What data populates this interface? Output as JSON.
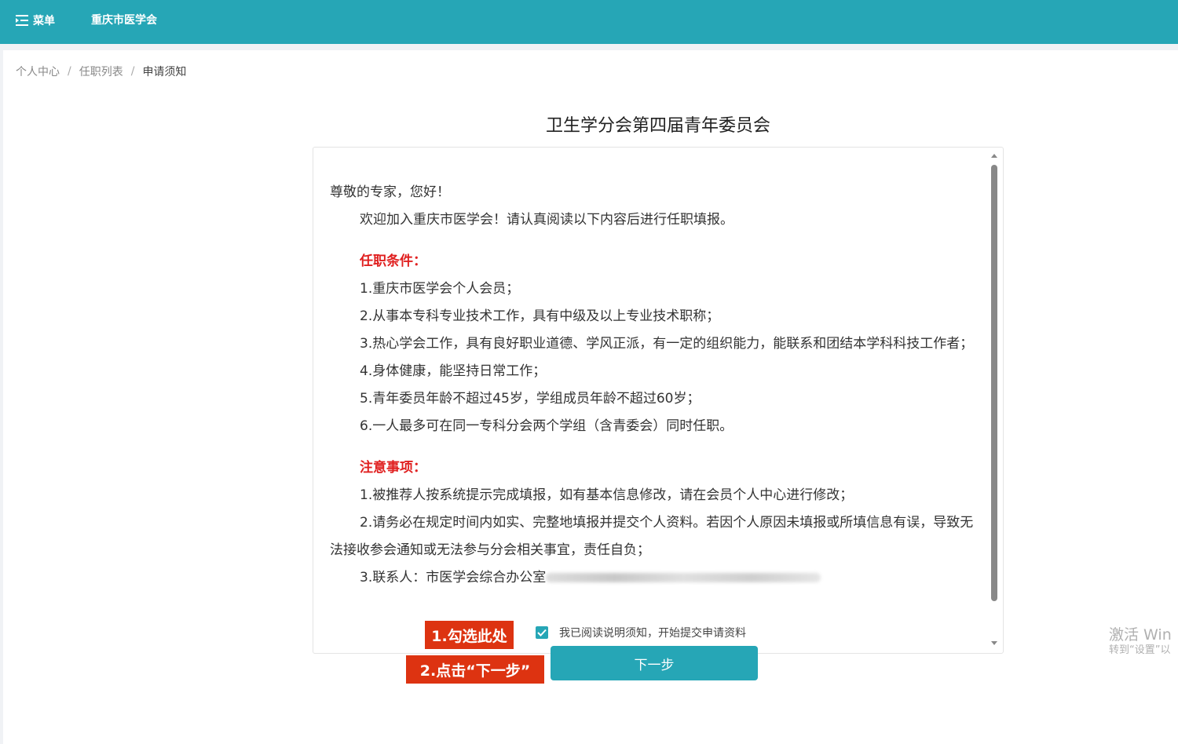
{
  "header": {
    "menu_label": "菜单",
    "site_title": "重庆市医学会"
  },
  "breadcrumb": {
    "items": [
      "个人中心",
      "任职列表",
      "申请须知"
    ],
    "separator": "/"
  },
  "notice": {
    "title": "卫生学分会第四届青年委员会",
    "greeting": "尊敬的专家，您好！",
    "intro": "欢迎加入重庆市医学会！请认真阅读以下内容后进行任职填报。",
    "conditions_heading": "任职条件：",
    "conditions": [
      "1.重庆市医学会个人会员；",
      "2.从事本专科专业技术工作，具有中级及以上专业技术职称；",
      "3.热心学会工作，具有良好职业道德、学风正派，有一定的组织能力，能联系和团结本学科科技工作者；",
      "4.身体健康，能坚持日常工作；",
      "5.青年委员年龄不超过45岁，学组成员年龄不超过60岁；",
      "6.一人最多可在同一专科分会两个学组（含青委会）同时任职。"
    ],
    "notes_heading": "注意事项：",
    "notes": [
      "1.被推荐人按系统提示完成填报，如有基本信息修改，请在会员个人中心进行修改；",
      "2.请务必在规定时间内如实、完整地填报并提交个人资料。若因个人原因未填报或所填信息有误，导致无法接收参会通知或无法参与分会相关事宜，责任自负；"
    ],
    "contact_prefix": "3.联系人：市医学会综合办公室"
  },
  "annotations": {
    "step1": "1.勾选此处",
    "step2": "2.点击“下一步”"
  },
  "agreement": {
    "checked": true,
    "label": "我已阅读说明须知，开始提交申请资料"
  },
  "next_button_label": "下一步",
  "watermark": {
    "line1": "激活 Win",
    "line2": "转到“设置”以"
  },
  "colors": {
    "primary": "#26a6b6",
    "heading_red": "#e02020",
    "annotation_red": "#dd3311"
  }
}
